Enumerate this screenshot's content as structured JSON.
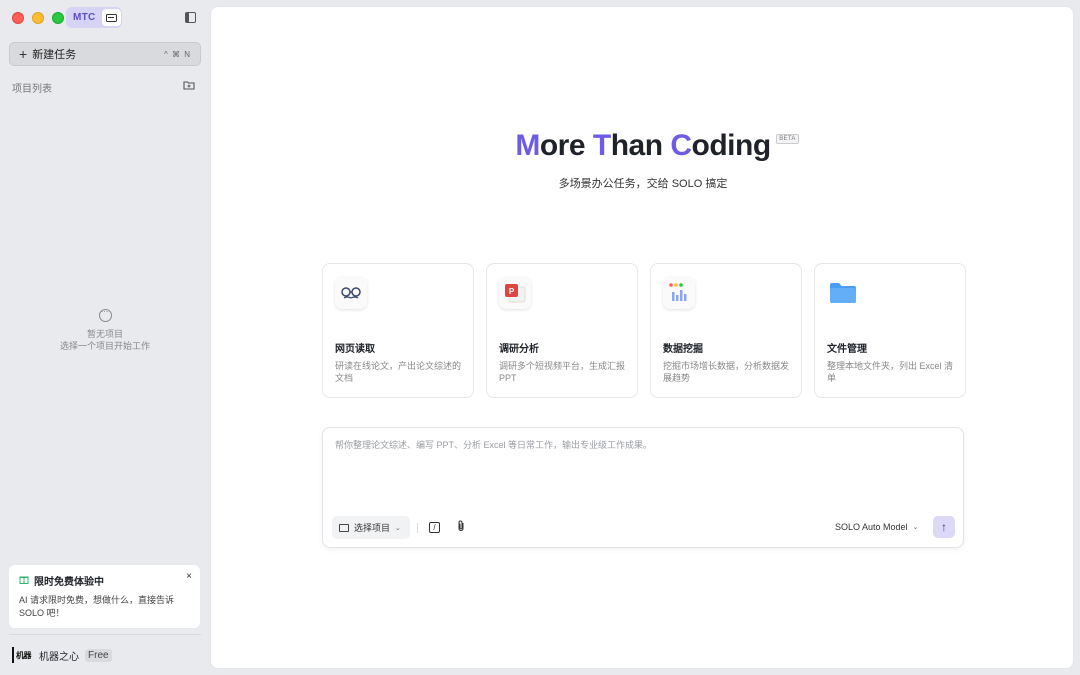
{
  "app": {
    "badge": "MTC"
  },
  "sidebar": {
    "new_task_label": "新建任务",
    "new_task_shortcut": "^ ⌘ N",
    "projects_title": "项目列表",
    "empty_line1": "暂无项目",
    "empty_line2": "选择一个项目开始工作",
    "promo": {
      "title": "限时免费体验中",
      "close": "×",
      "body": "AI 请求限时免费，想做什么，直接告诉 SOLO 吧！"
    },
    "user": {
      "logo_text": "机器",
      "name": "机器之心",
      "plan": "Free"
    }
  },
  "hero": {
    "title_parts": [
      "M",
      "ore ",
      "T",
      "han ",
      "C",
      "oding"
    ],
    "beta": "BETA",
    "subtitle": "多场景办公任务，交给 SOLO 搞定"
  },
  "cards": [
    {
      "icon": "glasses-icon",
      "title": "网页读取",
      "desc": "研读在线论文，产出论文综述的文档"
    },
    {
      "icon": "ppt-icon",
      "title": "调研分析",
      "desc": "调研多个短视频平台，生成汇报 PPT"
    },
    {
      "icon": "chart-icon",
      "title": "数据挖掘",
      "desc": "挖掘市场增长数据，分析数据发展趋势"
    },
    {
      "icon": "folder-icon",
      "title": "文件管理",
      "desc": "整理本地文件夹，列出 Excel 清单"
    }
  ],
  "composer": {
    "placeholder": "帮你整理论文综述、编写 PPT、分析 Excel 等日常工作，输出专业级工作成果。",
    "project_select": "选择项目",
    "model": "SOLO Auto Model",
    "send": "↑"
  },
  "colors": {
    "accent": "#6e5ce6",
    "send_bg": "#dcd8f7",
    "sidebar_bg": "#e9eaee"
  }
}
